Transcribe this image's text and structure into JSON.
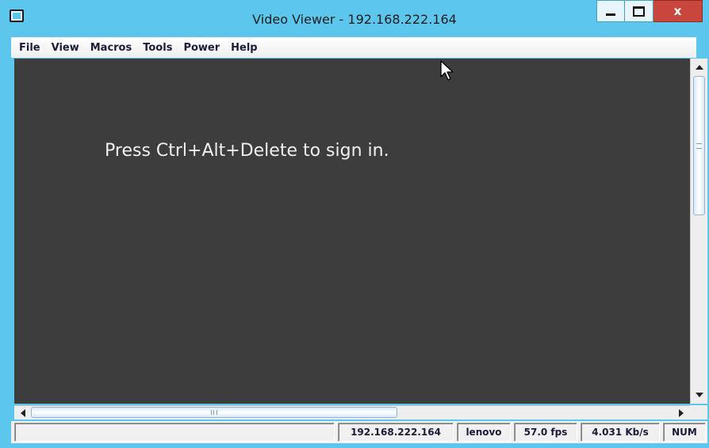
{
  "window": {
    "title": "Video Viewer - 192.168.222.164",
    "close_label": "x"
  },
  "menu": {
    "items": [
      "File",
      "View",
      "Macros",
      "Tools",
      "Power",
      "Help"
    ]
  },
  "viewer": {
    "message": "Press Ctrl+Alt+Delete to sign in.",
    "background_color": "#3d3d3d"
  },
  "status": {
    "blank": "",
    "host": "192.168.222.164",
    "user": "lenovo",
    "fps": "57.0 fps",
    "bitrate": "4.031 Kb/s",
    "lock": "NUM"
  },
  "theme": {
    "titlebar_color": "#5cc6ec",
    "close_color": "#c9463d"
  }
}
